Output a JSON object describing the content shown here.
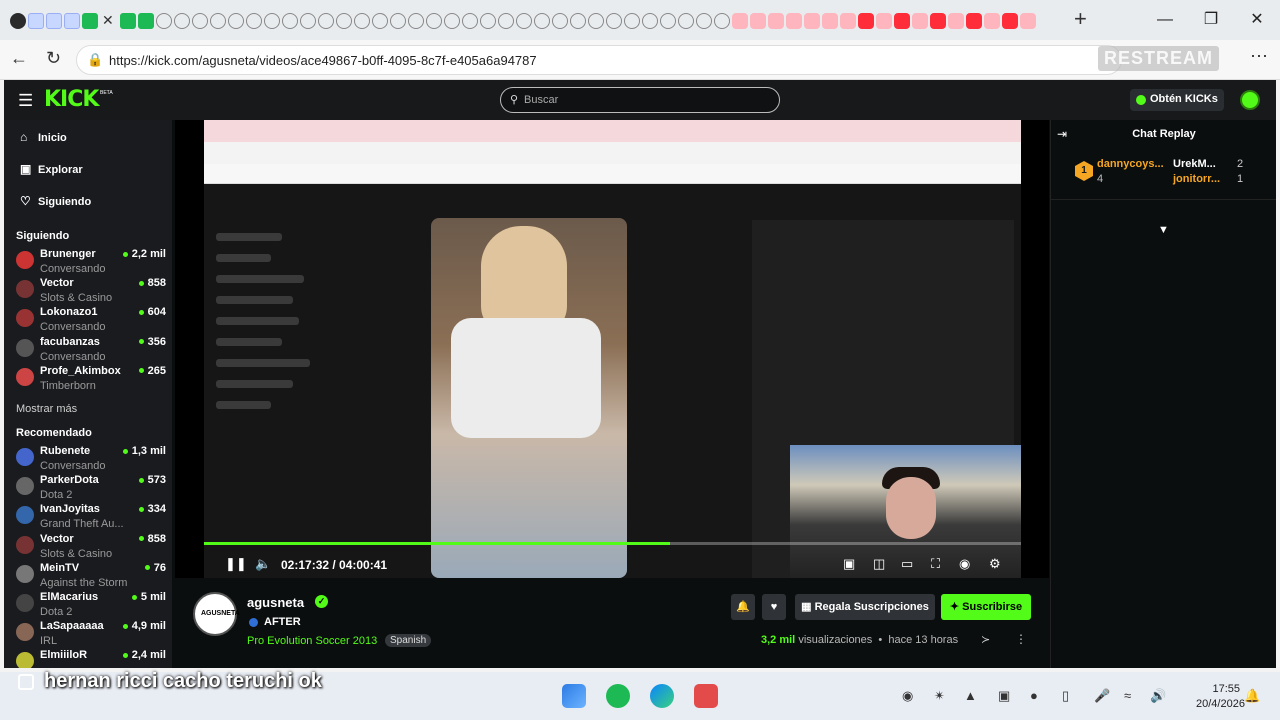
{
  "browser": {
    "url": "https://kick.com/agusneta/videos/ace49867-b0ff-4095-8c7f-e405a6a94787",
    "overlay": "RESTREAM"
  },
  "kick": {
    "logo": "KICK",
    "beta": "BETA",
    "search_placeholder": "Buscar",
    "obten": "Obtén KICKs"
  },
  "sidebar": {
    "nav": [
      "Inicio",
      "Explorar",
      "Siguiendo"
    ],
    "following_title": "Siguiendo",
    "following": [
      {
        "name": "Brunenger",
        "cat": "Conversando",
        "viewers": "2,2 mil",
        "color": "#c33"
      },
      {
        "name": "Vector",
        "cat": "Slots & Casino",
        "viewers": "858",
        "color": "#733"
      },
      {
        "name": "Lokonazo1",
        "cat": "Conversando",
        "viewers": "604",
        "color": "#933"
      },
      {
        "name": "facubanzas",
        "cat": "Conversando",
        "viewers": "356",
        "color": "#555"
      },
      {
        "name": "Profe_Akimbox",
        "cat": "Timberborn",
        "viewers": "265",
        "color": "#c44"
      }
    ],
    "show_more": "Mostrar más",
    "recommended_title": "Recomendado",
    "recommended": [
      {
        "name": "Rubenete",
        "cat": "Conversando",
        "viewers": "1,3 mil",
        "color": "#46c"
      },
      {
        "name": "ParkerDota",
        "cat": "Dota 2",
        "viewers": "573",
        "color": "#666"
      },
      {
        "name": "IvanJoyitas",
        "cat": "Grand Theft Au...",
        "viewers": "334",
        "color": "#36a"
      },
      {
        "name": "Vector",
        "cat": "Slots & Casino",
        "viewers": "858",
        "color": "#733"
      },
      {
        "name": "MeinTV",
        "cat": "Against the Storm",
        "viewers": "76",
        "color": "#777"
      },
      {
        "name": "ElMacarius",
        "cat": "Dota 2",
        "viewers": "5 mil",
        "color": "#444"
      },
      {
        "name": "LaSapaaaaa",
        "cat": "IRL",
        "viewers": "4,9 mil",
        "color": "#865"
      },
      {
        "name": "ElmiiiloR",
        "cat": "",
        "viewers": "2,4 mil",
        "color": "#bb3"
      }
    ]
  },
  "player": {
    "time": "02:17:32 / 04:00:41",
    "progress": 0.57
  },
  "chat": {
    "title": "Chat Replay",
    "gifter": "dannycoys...",
    "gift_count": "4",
    "rank": "1",
    "recv1": "UrekM...",
    "recv1_count": "2",
    "recv2": "jonitorr...",
    "recv2_count": "1"
  },
  "stream": {
    "channel": "agusneta",
    "avatar_text": "AGUSNETA",
    "title": "AFTER",
    "category": "Pro Evolution Soccer 2013",
    "language": "Spanish",
    "gift_label": "Regala Suscripciones",
    "subscribe_label": "Suscribirse",
    "views": "3,2 mil",
    "views_label": "visualizaciones",
    "ago": "hace 13 horas"
  },
  "overlay_subtitle": "hernan ricci cacho teruchi ok",
  "taskbar": {
    "time": "17:55",
    "date": "20/4/2026"
  }
}
